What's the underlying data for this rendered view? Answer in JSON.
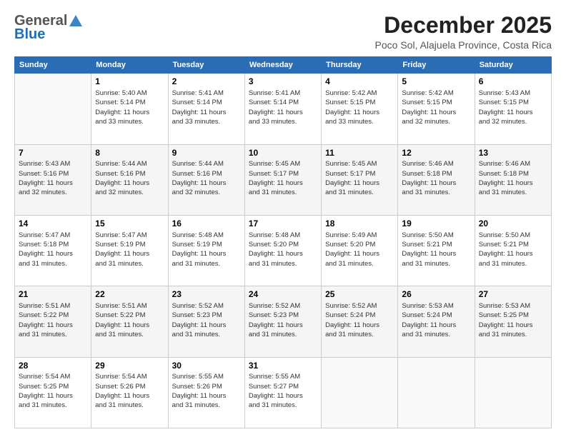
{
  "logo": {
    "general": "General",
    "blue": "Blue"
  },
  "header": {
    "month": "December 2025",
    "location": "Poco Sol, Alajuela Province, Costa Rica"
  },
  "weekdays": [
    "Sunday",
    "Monday",
    "Tuesday",
    "Wednesday",
    "Thursday",
    "Friday",
    "Saturday"
  ],
  "weeks": [
    [
      {
        "day": "",
        "info": ""
      },
      {
        "day": "1",
        "info": "Sunrise: 5:40 AM\nSunset: 5:14 PM\nDaylight: 11 hours\nand 33 minutes."
      },
      {
        "day": "2",
        "info": "Sunrise: 5:41 AM\nSunset: 5:14 PM\nDaylight: 11 hours\nand 33 minutes."
      },
      {
        "day": "3",
        "info": "Sunrise: 5:41 AM\nSunset: 5:14 PM\nDaylight: 11 hours\nand 33 minutes."
      },
      {
        "day": "4",
        "info": "Sunrise: 5:42 AM\nSunset: 5:15 PM\nDaylight: 11 hours\nand 33 minutes."
      },
      {
        "day": "5",
        "info": "Sunrise: 5:42 AM\nSunset: 5:15 PM\nDaylight: 11 hours\nand 32 minutes."
      },
      {
        "day": "6",
        "info": "Sunrise: 5:43 AM\nSunset: 5:15 PM\nDaylight: 11 hours\nand 32 minutes."
      }
    ],
    [
      {
        "day": "7",
        "info": "Sunrise: 5:43 AM\nSunset: 5:16 PM\nDaylight: 11 hours\nand 32 minutes."
      },
      {
        "day": "8",
        "info": "Sunrise: 5:44 AM\nSunset: 5:16 PM\nDaylight: 11 hours\nand 32 minutes."
      },
      {
        "day": "9",
        "info": "Sunrise: 5:44 AM\nSunset: 5:16 PM\nDaylight: 11 hours\nand 32 minutes."
      },
      {
        "day": "10",
        "info": "Sunrise: 5:45 AM\nSunset: 5:17 PM\nDaylight: 11 hours\nand 31 minutes."
      },
      {
        "day": "11",
        "info": "Sunrise: 5:45 AM\nSunset: 5:17 PM\nDaylight: 11 hours\nand 31 minutes."
      },
      {
        "day": "12",
        "info": "Sunrise: 5:46 AM\nSunset: 5:18 PM\nDaylight: 11 hours\nand 31 minutes."
      },
      {
        "day": "13",
        "info": "Sunrise: 5:46 AM\nSunset: 5:18 PM\nDaylight: 11 hours\nand 31 minutes."
      }
    ],
    [
      {
        "day": "14",
        "info": "Sunrise: 5:47 AM\nSunset: 5:18 PM\nDaylight: 11 hours\nand 31 minutes."
      },
      {
        "day": "15",
        "info": "Sunrise: 5:47 AM\nSunset: 5:19 PM\nDaylight: 11 hours\nand 31 minutes."
      },
      {
        "day": "16",
        "info": "Sunrise: 5:48 AM\nSunset: 5:19 PM\nDaylight: 11 hours\nand 31 minutes."
      },
      {
        "day": "17",
        "info": "Sunrise: 5:48 AM\nSunset: 5:20 PM\nDaylight: 11 hours\nand 31 minutes."
      },
      {
        "day": "18",
        "info": "Sunrise: 5:49 AM\nSunset: 5:20 PM\nDaylight: 11 hours\nand 31 minutes."
      },
      {
        "day": "19",
        "info": "Sunrise: 5:50 AM\nSunset: 5:21 PM\nDaylight: 11 hours\nand 31 minutes."
      },
      {
        "day": "20",
        "info": "Sunrise: 5:50 AM\nSunset: 5:21 PM\nDaylight: 11 hours\nand 31 minutes."
      }
    ],
    [
      {
        "day": "21",
        "info": "Sunrise: 5:51 AM\nSunset: 5:22 PM\nDaylight: 11 hours\nand 31 minutes."
      },
      {
        "day": "22",
        "info": "Sunrise: 5:51 AM\nSunset: 5:22 PM\nDaylight: 11 hours\nand 31 minutes."
      },
      {
        "day": "23",
        "info": "Sunrise: 5:52 AM\nSunset: 5:23 PM\nDaylight: 11 hours\nand 31 minutes."
      },
      {
        "day": "24",
        "info": "Sunrise: 5:52 AM\nSunset: 5:23 PM\nDaylight: 11 hours\nand 31 minutes."
      },
      {
        "day": "25",
        "info": "Sunrise: 5:52 AM\nSunset: 5:24 PM\nDaylight: 11 hours\nand 31 minutes."
      },
      {
        "day": "26",
        "info": "Sunrise: 5:53 AM\nSunset: 5:24 PM\nDaylight: 11 hours\nand 31 minutes."
      },
      {
        "day": "27",
        "info": "Sunrise: 5:53 AM\nSunset: 5:25 PM\nDaylight: 11 hours\nand 31 minutes."
      }
    ],
    [
      {
        "day": "28",
        "info": "Sunrise: 5:54 AM\nSunset: 5:25 PM\nDaylight: 11 hours\nand 31 minutes."
      },
      {
        "day": "29",
        "info": "Sunrise: 5:54 AM\nSunset: 5:26 PM\nDaylight: 11 hours\nand 31 minutes."
      },
      {
        "day": "30",
        "info": "Sunrise: 5:55 AM\nSunset: 5:26 PM\nDaylight: 11 hours\nand 31 minutes."
      },
      {
        "day": "31",
        "info": "Sunrise: 5:55 AM\nSunset: 5:27 PM\nDaylight: 11 hours\nand 31 minutes."
      },
      {
        "day": "",
        "info": ""
      },
      {
        "day": "",
        "info": ""
      },
      {
        "day": "",
        "info": ""
      }
    ]
  ]
}
